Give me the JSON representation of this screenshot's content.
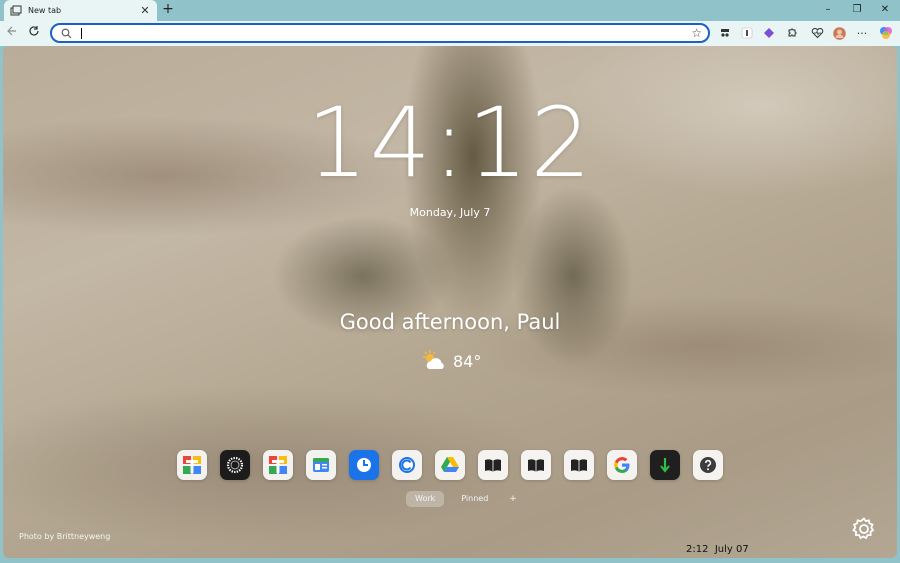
{
  "browser": {
    "tab_title": "New tab",
    "tab_close": "✕",
    "new_tab": "+",
    "minimize": "–",
    "restore": "❐",
    "close": "✕",
    "address_value": "",
    "address_placeholder": "",
    "more_menu": "···"
  },
  "newtab": {
    "clock": "14:12",
    "date": "Monday, July 7",
    "greeting": "Good afternoon, Paul",
    "temperature": "84°",
    "weather_icon": "partly-sunny-icon",
    "quick_link_tabs": [
      "Work",
      "Pinned"
    ],
    "active_tab": "Work",
    "add_tab": "+",
    "photo_credit": "Photo by Brittneyweng"
  },
  "quick_links": [
    {
      "icon": "office-tiles-icon"
    },
    {
      "icon": "dark-circle-app-icon"
    },
    {
      "icon": "office-tiles-icon"
    },
    {
      "icon": "news-g-icon"
    },
    {
      "icon": "blue-clock-app-icon"
    },
    {
      "icon": "blue-c-circle-icon"
    },
    {
      "icon": "google-drive-icon"
    },
    {
      "icon": "open-book-icon"
    },
    {
      "icon": "open-book-icon"
    },
    {
      "icon": "open-book-icon"
    },
    {
      "icon": "google-g-icon"
    },
    {
      "icon": "green-arrow-app-icon"
    },
    {
      "icon": "help-question-icon"
    }
  ],
  "taskbar": {
    "time": "2:12",
    "date": "July 07"
  },
  "colors": {
    "tab_bar": "#8fc3c9",
    "toolbar": "#e9f4f5",
    "address_border": "#1d5fc9"
  }
}
